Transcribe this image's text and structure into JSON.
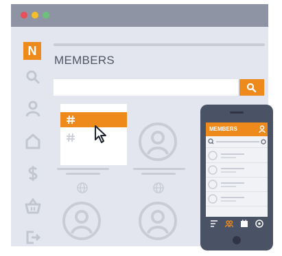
{
  "app": {
    "title": "MEMBERS",
    "logo_letter": "N"
  },
  "sidebar": {
    "items": [
      {
        "icon": "search-icon"
      },
      {
        "icon": "user-icon"
      },
      {
        "icon": "home-icon"
      },
      {
        "icon": "dollar-icon"
      },
      {
        "icon": "basket-icon"
      },
      {
        "icon": "logout-icon"
      }
    ]
  },
  "search": {
    "icon": "search-icon"
  },
  "dropdown": {
    "items": [
      {
        "icon": "hash-icon",
        "active": true
      },
      {
        "icon": "hash-icon",
        "active": false
      }
    ]
  },
  "phone": {
    "title": "MEMBERS",
    "nav": [
      "list-icon",
      "people-icon",
      "calendar-icon",
      "settings-icon"
    ]
  },
  "colors": {
    "accent": "#ee8a1c",
    "background": "#e3e6ee",
    "titlebar": "#8e94a3",
    "dot_red": "#e84f5a",
    "dot_yellow": "#f4bf2a",
    "dot_green": "#6fc07a",
    "phone_body": "#4a5266"
  }
}
